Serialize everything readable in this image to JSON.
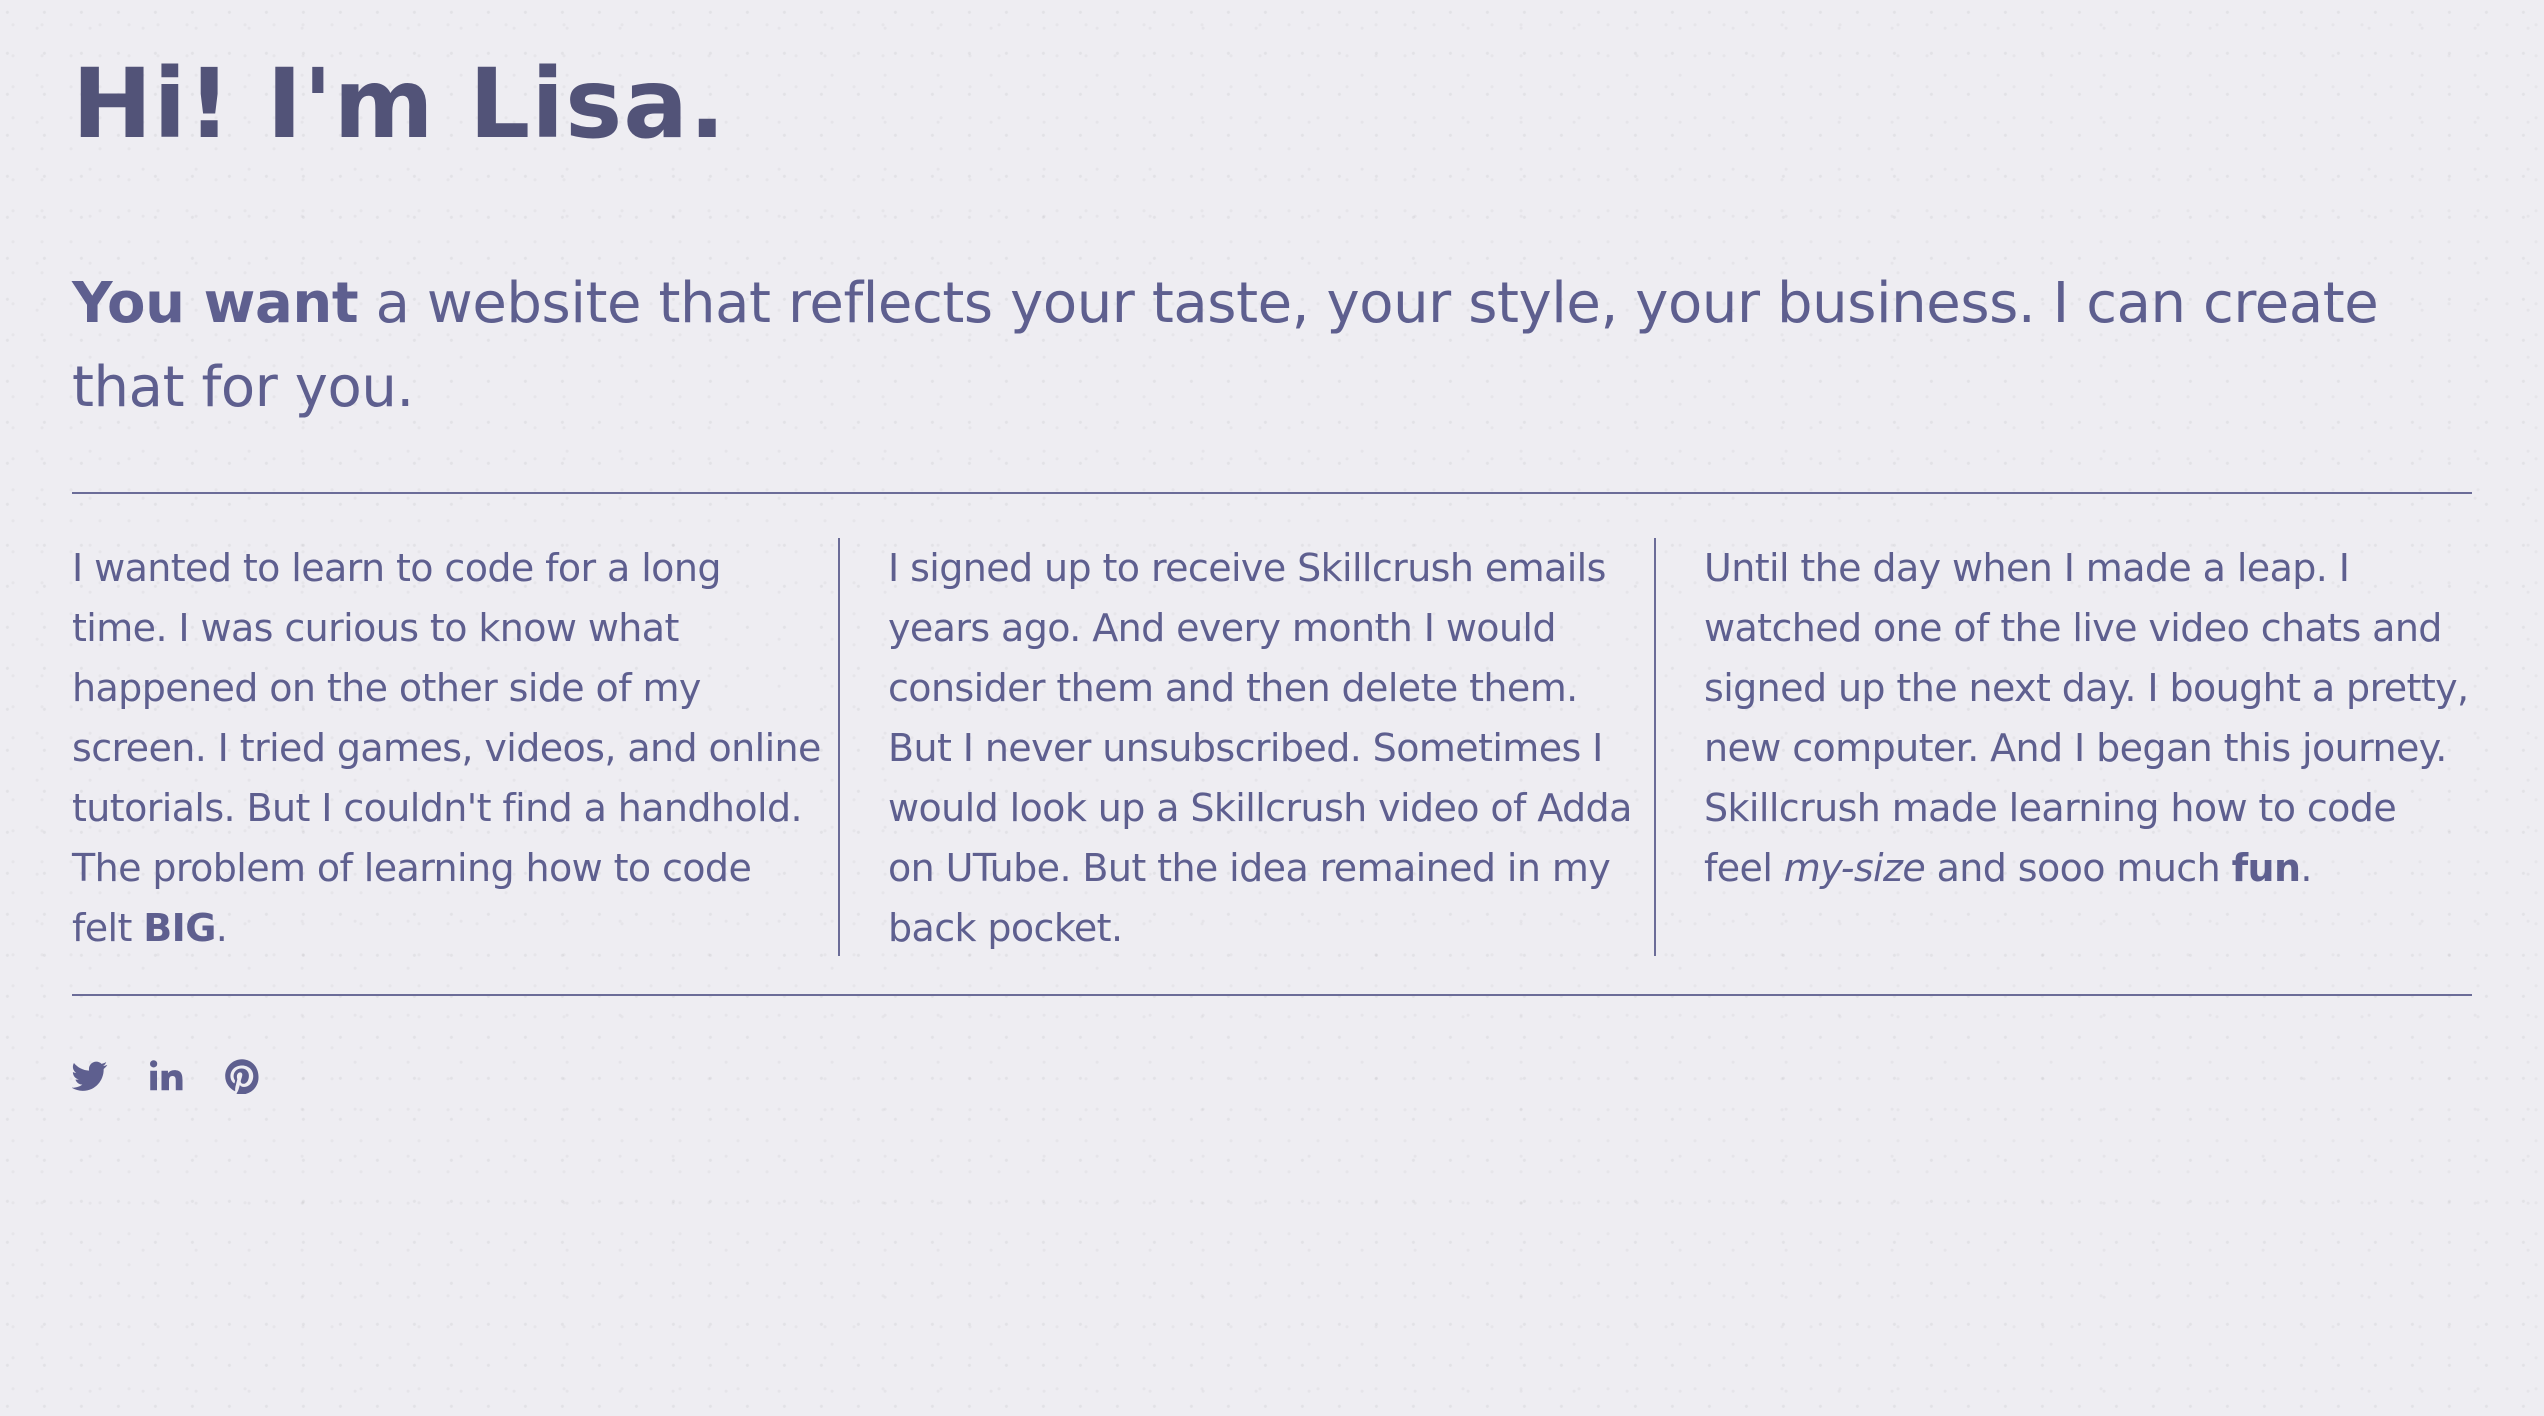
{
  "header": {
    "title": "Hi! I'm Lisa."
  },
  "intro": {
    "lead": "You want",
    "rest": " a website that reflects your taste, your style, your business. I can create that for you."
  },
  "columns": [
    {
      "text_before": "I wanted to learn to code for a long time. I was curious to know what happened on the other side of my screen. I tried games, videos, and online tutorials. But I couldn't find a handhold. The problem of learning how to code felt ",
      "bold": "BIG",
      "text_after": "."
    },
    {
      "text": "I signed up to receive Skillcrush emails years ago. And every month I would consider them and then delete them. But I never unsubscribed. Sometimes I would look up a Skillcrush video of Adda on UTube. But the idea remained in my back pocket."
    },
    {
      "text_before": "Until the day when I made a leap. I watched one of the live video chats and signed up the next day. I bought a pretty, new computer. And I began this journey. Skillcrush made learning how to code feel ",
      "italic": "my-size",
      "text_middle": " and sooo much ",
      "bold": "fun",
      "text_after": "."
    }
  ],
  "social": [
    {
      "icon": "twitter-icon"
    },
    {
      "icon": "linkedin-icon"
    },
    {
      "icon": "pinterest-icon"
    }
  ],
  "colors": {
    "background": "#eeedf2",
    "text": "#5e5f8f",
    "title": "#525378",
    "rule": "#6b6c98"
  }
}
